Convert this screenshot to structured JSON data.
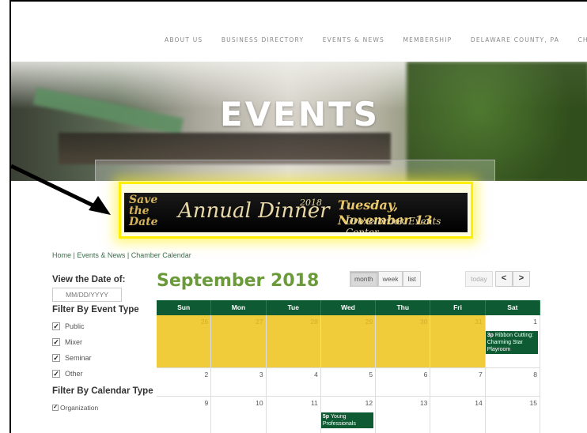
{
  "nav": [
    "ABOUT US",
    "BUSINESS DIRECTORY",
    "EVENTS & NEWS",
    "MEMBERSHIP",
    "DELAWARE COUNTY, PA",
    "CHAMBER FO"
  ],
  "hero": {
    "title": "EVENTS"
  },
  "banner": {
    "save_the_date": "Save the Date",
    "event_name": "Annual Dinner",
    "year": "2018",
    "date": "Tuesday, November 13",
    "venue": "Drexelbrook Events Center"
  },
  "breadcrumb": "Home | Events & News | Chamber Calendar",
  "sidebar": {
    "view_date_heading": "View the Date of:",
    "date_placeholder": "MM/DD/YYYY",
    "event_type_heading": "Filter By Event Type",
    "event_types": [
      "Public",
      "Mixer",
      "Seminar",
      "Other"
    ],
    "calendar_type_heading": "Filter By Calendar Type",
    "calendar_types": [
      "Organization"
    ]
  },
  "calendar": {
    "title": "September 2018",
    "views": [
      "month",
      "week",
      "list"
    ],
    "active_view": "month",
    "today_label": "today",
    "prev_label": "<",
    "next_label": ">",
    "weekdays": [
      "Sun",
      "Mon",
      "Tue",
      "Wed",
      "Thu",
      "Fri",
      "Sat"
    ],
    "weeks": [
      {
        "days": [
          "26",
          "27",
          "28",
          "29",
          "30",
          "31",
          "1"
        ],
        "other": [
          true,
          true,
          true,
          true,
          true,
          true,
          false
        ]
      },
      {
        "days": [
          "2",
          "3",
          "4",
          "5",
          "6",
          "7",
          "8"
        ],
        "other": [
          false,
          false,
          false,
          false,
          false,
          false,
          false
        ]
      },
      {
        "days": [
          "9",
          "10",
          "11",
          "12",
          "13",
          "14",
          "15"
        ],
        "other": [
          false,
          false,
          false,
          false,
          false,
          false,
          false
        ]
      }
    ],
    "events": [
      {
        "week": 0,
        "day": 6,
        "time": "3p",
        "title": "Ribbon Cutting: Charming Star Playroom"
      },
      {
        "week": 2,
        "day": 3,
        "time": "5p",
        "title": "Young Professionals"
      }
    ]
  },
  "colors": {
    "primary_green": "#0e5a32",
    "title_green": "#6a9a3a",
    "highlight_yellow": "#ffef00",
    "other_month": "#f0cb3a"
  }
}
